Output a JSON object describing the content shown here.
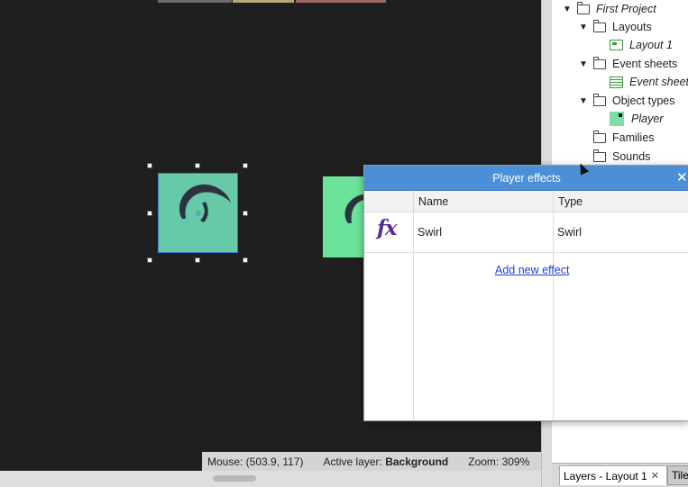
{
  "statusbar": {
    "mouse": "Mouse: (503.9, 117)",
    "active_layer_label": "Active layer:",
    "active_layer_value": "Background",
    "zoom": "Zoom: 309%"
  },
  "project_tree": [
    {
      "label": "First Project",
      "italic": true
    },
    {
      "label": "Layouts"
    },
    {
      "label": "Layout 1",
      "italic": true
    },
    {
      "label": "Event sheets"
    },
    {
      "label": "Event sheet",
      "italic": true
    },
    {
      "label": "Object types"
    },
    {
      "label": "Player",
      "italic": true
    },
    {
      "label": "Families"
    },
    {
      "label": "Sounds"
    }
  ],
  "bottom_tabs": {
    "active": "Layers - Layout 1",
    "other": "Tile"
  },
  "dialog": {
    "title": "Player effects",
    "columns": [
      "Name",
      "Type"
    ],
    "rows": [
      {
        "icon": "fx",
        "name": "Swirl",
        "type": "Swirl"
      }
    ],
    "add_link": "Add new effect"
  },
  "colors": {
    "canvas": "#1f1f1f",
    "dialog_title": "#4b8fd6",
    "sprite": "#66c9a8",
    "sprite2": "#6be39a",
    "link": "#1f3fe0",
    "fx": "#5a2a96"
  }
}
